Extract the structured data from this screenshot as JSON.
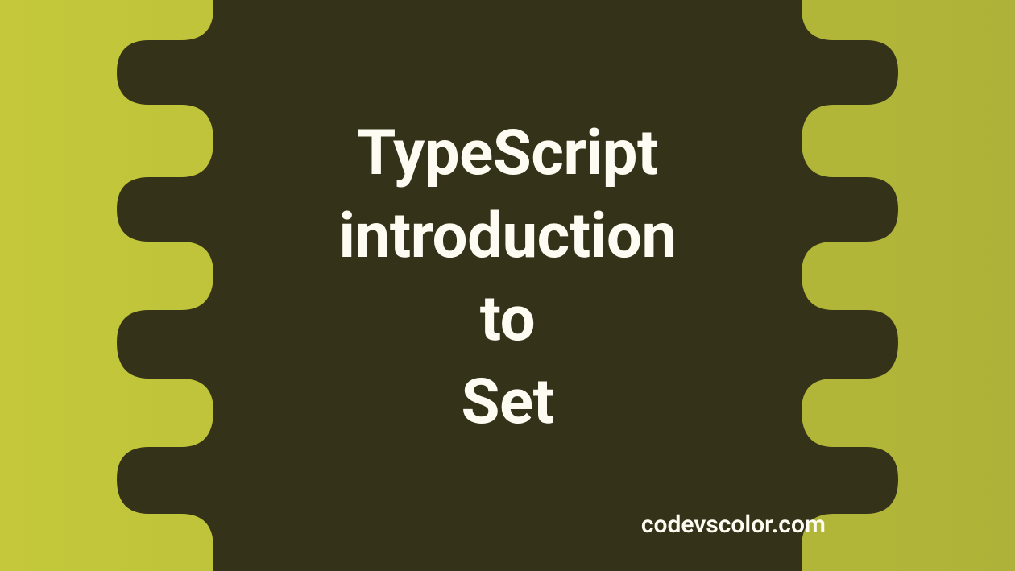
{
  "title": {
    "line1": "TypeScript",
    "line2": "introduction",
    "line3": "to",
    "line4": "Set"
  },
  "watermark": "codevscolor.com",
  "colors": {
    "blob": "#35321a",
    "text": "#fefcf2",
    "bgStart": "#c4c83a",
    "bgEnd": "#aeb238"
  }
}
